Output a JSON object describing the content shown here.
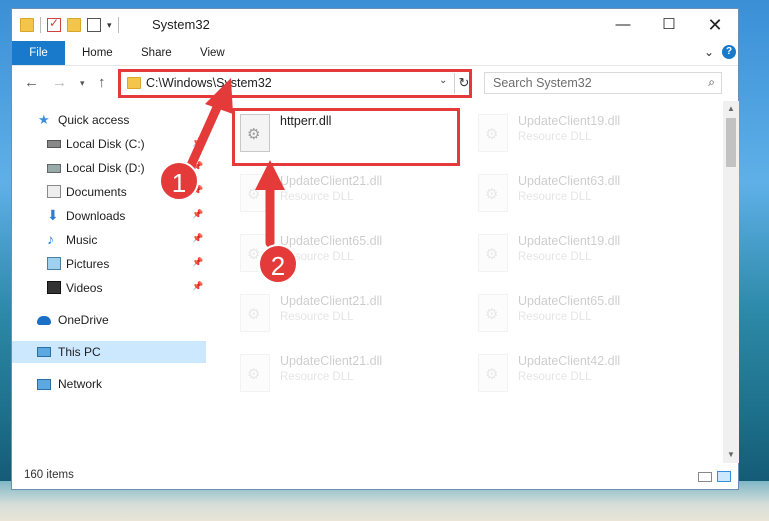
{
  "window": {
    "title": "System32"
  },
  "ribbon": {
    "tabs": [
      "File",
      "Home",
      "Share",
      "View"
    ],
    "help": "?"
  },
  "address": {
    "path": "C:\\Windows\\System32"
  },
  "search": {
    "placeholder": "Search System32"
  },
  "sidebar": {
    "items": [
      {
        "label": "Quick access",
        "icon": "star-icon"
      },
      {
        "label": "Local Disk (C:)",
        "icon": "drive-icon",
        "pinned": true
      },
      {
        "label": "Local Disk (D:)",
        "icon": "drive-icon",
        "pinned": true
      },
      {
        "label": "Documents",
        "icon": "documents-icon",
        "pinned": true
      },
      {
        "label": "Downloads",
        "icon": "download-icon",
        "pinned": true
      },
      {
        "label": "Music",
        "icon": "music-icon",
        "pinned": true
      },
      {
        "label": "Pictures",
        "icon": "pictures-icon",
        "pinned": true
      },
      {
        "label": "Videos",
        "icon": "videos-icon",
        "pinned": true
      },
      {
        "label": "OneDrive",
        "icon": "cloud-icon"
      },
      {
        "label": "This PC",
        "icon": "computer-icon",
        "selected": true
      },
      {
        "label": "Network",
        "icon": "network-icon"
      }
    ]
  },
  "files": {
    "highlighted": {
      "name": "httperr.dll",
      "type": ""
    },
    "items": [
      {
        "name": "UpdateClient19.dll",
        "type": "Resource DLL"
      },
      {
        "name": "UpdateClient21.dll",
        "type": "Resource DLL"
      },
      {
        "name": "UpdateClient63.dll",
        "type": "Resource DLL"
      },
      {
        "name": "UpdateClient65.dll",
        "type": "Resource DLL"
      },
      {
        "name": "UpdateClient19.dll",
        "type": "Resource DLL"
      },
      {
        "name": "UpdateClient21.dll",
        "type": "Resource DLL"
      },
      {
        "name": "UpdateClient65.dll",
        "type": "Resource DLL"
      },
      {
        "name": "UpdateClient21.dll",
        "type": "Resource DLL"
      },
      {
        "name": "UpdateClient42.dll",
        "type": "Resource DLL"
      }
    ]
  },
  "status": {
    "count": "160 items"
  },
  "annotations": {
    "badge1": "1",
    "badge2": "2",
    "color": "#e53a3a"
  }
}
